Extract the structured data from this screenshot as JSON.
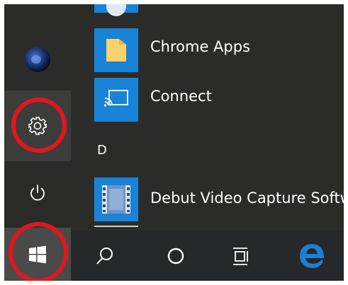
{
  "start_menu": {
    "section_letter": "D",
    "apps": [
      {
        "label": "Chrome Apps",
        "icon": "folder-icon"
      },
      {
        "label": "Connect",
        "icon": "connect-cast-icon"
      },
      {
        "label": "Debut Video Capture Softw",
        "icon": "film-strip-icon"
      }
    ]
  },
  "rail": {
    "items": [
      "user-avatar",
      "settings-gear-icon",
      "power-icon",
      "windows-start-icon"
    ]
  },
  "taskbar": {
    "items": [
      "search-icon",
      "cortana-icon",
      "task-view-icon",
      "edge-browser-icon"
    ]
  },
  "colors": {
    "background": "#2b2c2a",
    "tile_blue": "#1883d7",
    "highlight_ring": "#e0171f",
    "edge_blue": "#1a7fd6"
  }
}
